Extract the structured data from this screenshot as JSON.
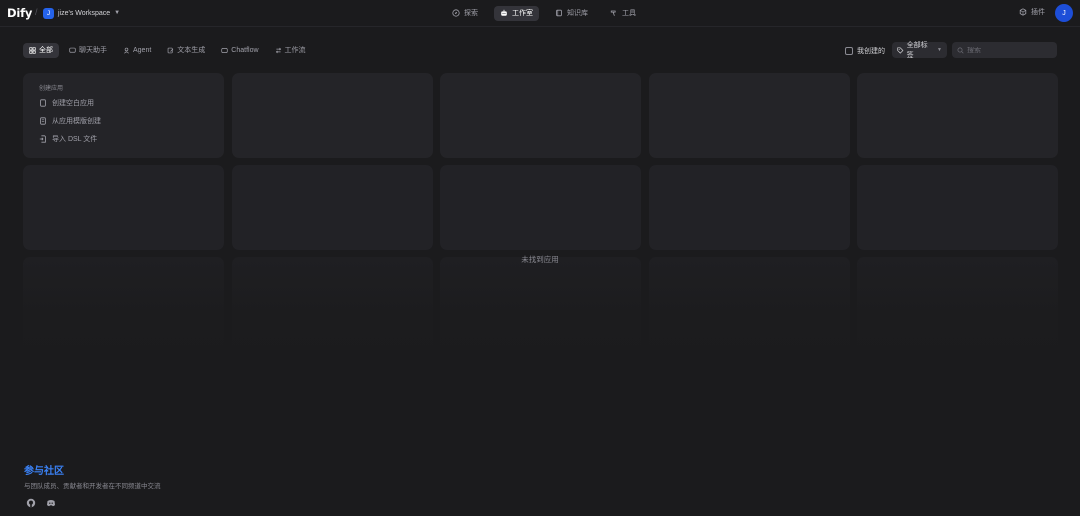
{
  "header": {
    "logo": "Dify",
    "separator": "/",
    "workspace_badge": "J",
    "workspace_name": "jize's Workspace",
    "nav": [
      {
        "label": "探索",
        "icon": "compass-icon",
        "active": false
      },
      {
        "label": "工作室",
        "icon": "robot-icon",
        "active": true
      },
      {
        "label": "知识库",
        "icon": "book-icon",
        "active": false
      },
      {
        "label": "工具",
        "icon": "hammer-icon",
        "active": false
      }
    ],
    "plugins_label": "插件",
    "avatar_initial": "J"
  },
  "filters": {
    "tabs": [
      {
        "label": "全部",
        "icon": "grid-icon",
        "active": true
      },
      {
        "label": "聊天助手",
        "icon": "chat-icon",
        "active": false
      },
      {
        "label": "Agent",
        "icon": "agent-icon",
        "active": false
      },
      {
        "label": "文本生成",
        "icon": "edit-icon",
        "active": false
      },
      {
        "label": "Chatflow",
        "icon": "chatflow-icon",
        "active": false
      },
      {
        "label": "工作流",
        "icon": "workflow-icon",
        "active": false
      }
    ],
    "my_created_label": "我创建的",
    "tags_label": "全部标签",
    "search_placeholder": "搜索"
  },
  "create_card": {
    "title": "创建应用",
    "items": [
      {
        "label": "创建空白应用",
        "icon": "blank-file-icon"
      },
      {
        "label": "从应用模版创建",
        "icon": "template-icon"
      },
      {
        "label": "导入 DSL 文件",
        "icon": "import-file-icon"
      }
    ]
  },
  "empty_state": "未找到应用",
  "community": {
    "title": "参与社区",
    "description": "与团队成员、贡献者和开发者在不同频道中交流",
    "icons": [
      "github-icon",
      "discord-icon"
    ]
  },
  "colors": {
    "background": "#1b1b1d",
    "accent": "#2563eb",
    "community_title": "#3b82f6"
  }
}
